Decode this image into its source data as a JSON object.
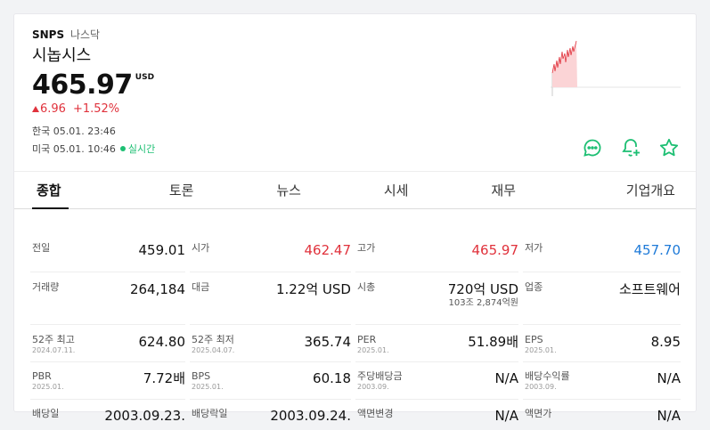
{
  "header": {
    "ticker": "SNPS",
    "exchange": "나스닥",
    "name": "시놉시스",
    "price": "465.97",
    "currency": "USD",
    "change": "6.96",
    "change_pct": "+1.52%",
    "time_kr": "한국 05.01. 23:46",
    "time_us": "미국 05.01. 10:46",
    "live": "실시간",
    "colors": {
      "up": "#e0323c",
      "down": "#1e7ad8",
      "action": "#1dbf73"
    }
  },
  "actions": [
    {
      "icon": "chat-icon"
    },
    {
      "icon": "bell-plus-icon"
    },
    {
      "icon": "star-icon"
    }
  ],
  "tabs": [
    "종합",
    "토론",
    "뉴스",
    "시세",
    "재무",
    "기업개요"
  ],
  "stats": {
    "prev_close": {
      "label": "전일",
      "value": "459.01"
    },
    "open": {
      "label": "시가",
      "value": "462.47"
    },
    "high": {
      "label": "고가",
      "value": "465.97"
    },
    "low": {
      "label": "저가",
      "value": "457.70"
    },
    "volume": {
      "label": "거래량",
      "value": "264,184"
    },
    "amount": {
      "label": "대금",
      "value": "1.22억 USD"
    },
    "market_cap": {
      "label": "시총",
      "value": "720억 USD",
      "sub": "103조 2,874억원"
    },
    "industry": {
      "label": "업종",
      "value": "소프트웨어"
    },
    "high52": {
      "label": "52주 최고",
      "date": "2024.07.11.",
      "value": "624.80"
    },
    "low52": {
      "label": "52주 최저",
      "date": "2025.04.07.",
      "value": "365.74"
    },
    "per": {
      "label": "PER",
      "date": "2025.01.",
      "value": "51.89배"
    },
    "eps": {
      "label": "EPS",
      "date": "2025.01.",
      "value": "8.95"
    },
    "pbr": {
      "label": "PBR",
      "date": "2025.01.",
      "value": "7.72배"
    },
    "bps": {
      "label": "BPS",
      "date": "2025.01.",
      "value": "60.18"
    },
    "dps": {
      "label": "주당배당금",
      "date": "2003.09.",
      "value": "N/A"
    },
    "div_yield": {
      "label": "배당수익률",
      "date": "2003.09.",
      "value": "N/A"
    },
    "div_date": {
      "label": "배당일",
      "value": "2003.09.23."
    },
    "exdiv_date": {
      "label": "배당락일",
      "value": "2003.09.24."
    },
    "par_change": {
      "label": "액면변경",
      "value": "N/A"
    },
    "par_value": {
      "label": "액면가",
      "value": "N/A"
    }
  }
}
